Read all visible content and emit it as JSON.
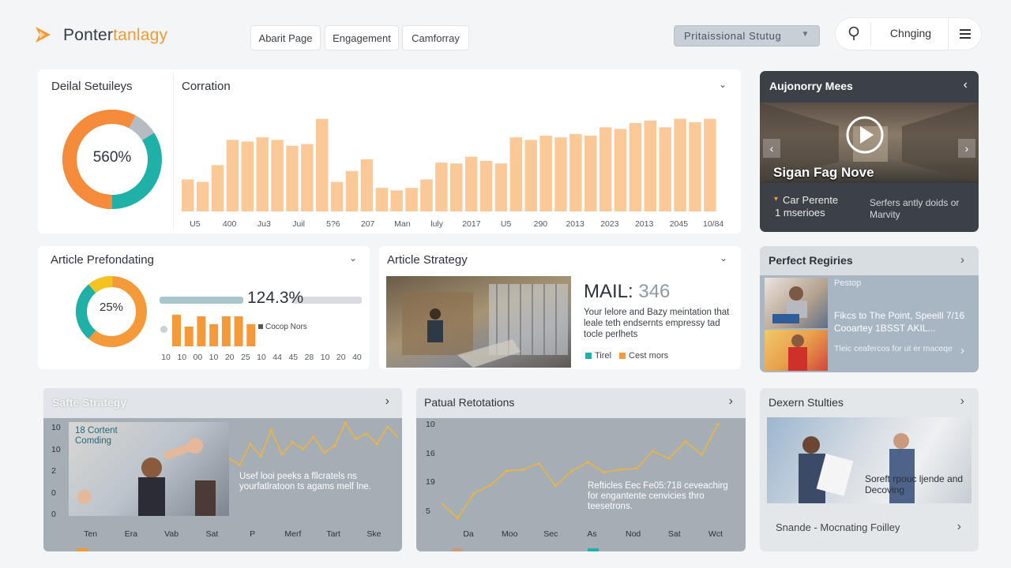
{
  "header": {
    "brand_part1": "Ponter",
    "brand_part2": "tanlagy",
    "nav": [
      "Abarit Page",
      "Engagement",
      "Camforray"
    ],
    "status_dropdown": "Pritaissional  Stutug",
    "right_label": "Chnging"
  },
  "colors": {
    "accent": "#f29a32",
    "teal": "#1fb0a8",
    "bar": "#fbc998",
    "dark_panel": "#3c4148"
  },
  "detail": {
    "title": "Deilal Setuileys",
    "donut_value": "560%"
  },
  "corration": {
    "title": "Corration"
  },
  "chart_data": [
    {
      "type": "bar",
      "title": "Corration",
      "values": [
        38,
        35,
        55,
        85,
        83,
        88,
        85,
        78,
        80,
        110,
        35,
        48,
        62,
        28,
        25,
        28,
        38,
        58,
        57,
        65,
        60,
        57,
        88,
        85,
        90,
        88,
        92,
        90,
        100,
        98,
        105,
        108,
        100,
        110,
        106,
        110
      ],
      "x_tick_labels": [
        "U5",
        "400",
        "Ju3",
        "Juil",
        "5?6",
        "207",
        "Man",
        "luly",
        "2017",
        "U5",
        "290",
        "2013",
        "2023",
        "2013",
        "2045",
        "10/84"
      ],
      "grid": false
    },
    {
      "type": "bar",
      "title": "Article Prefondating",
      "values": [
        40,
        25,
        38,
        28,
        38,
        38,
        28
      ],
      "x_tick_labels": [
        "10",
        "10",
        "00",
        "10",
        "20",
        "25",
        "10",
        "44",
        "45",
        "28",
        "10",
        "20",
        "40"
      ],
      "legend": [
        "Cocop Nors"
      ]
    },
    {
      "type": "line",
      "title": "Safte Strategy",
      "values": [
        55,
        48,
        72,
        58,
        88,
        60,
        74,
        66,
        80,
        62,
        70,
        96,
        78,
        84,
        72,
        92,
        80
      ],
      "y_tick_labels": [
        "10",
        "10",
        "2",
        "0",
        "0"
      ],
      "x_tick_labels": [
        "Ten",
        "Era",
        "Vab",
        "Sat",
        "P",
        "Merf",
        "Tart",
        "Ske"
      ]
    },
    {
      "type": "line",
      "title": "Patual Retotations",
      "values": [
        28,
        4,
        44,
        57,
        80,
        82,
        92,
        56,
        80,
        94,
        78,
        82,
        84,
        112,
        100,
        128,
        106,
        155
      ],
      "y_tick_labels": [
        "10",
        "16",
        "19",
        "5"
      ],
      "x_tick_labels": [
        "Da",
        "Moo",
        "Sec",
        "As",
        "Nod",
        "Sat",
        "Wct"
      ]
    }
  ],
  "autonomy": {
    "title": "Aujonorry Mees",
    "video_title": "Sigan Fag Nove",
    "meta_left1": "Car Perente",
    "meta_left2": "1 mserioes",
    "meta_right": "Serfers antly doids or Marvity"
  },
  "article_pref": {
    "title": "Article Prefondating",
    "donut_value": "25%",
    "big_value": "124.3%",
    "legend": "Cocop Nors"
  },
  "article_strategy": {
    "title": "Article Strategy",
    "metric_label": "MAIL:",
    "metric_value": "346",
    "desc": "Your lelore and Bazy meintation that leale teth endsernts empressy tad tocle perlhets",
    "legend1": "Tirel",
    "legend2": "Cest mors"
  },
  "perfect": {
    "title": "Perfect Regiries",
    "item1_label": "Pestop",
    "item1_text": "Fikcs to The Point, Speeill 7/16 Cooartey 1BSST AKIL...",
    "item2_text": "Tleic ceafercos for ut er maceqe"
  },
  "safte": {
    "title": "Safte Strategy",
    "card_title": "18 Cortent Comding",
    "desc": "Usef looi peeks a fllcratels ns yourfatlratoon ts agams melf lne."
  },
  "patual": {
    "title": "Patual Retotations",
    "desc": "Refticles Eec Fe05:718 ceveachirg for engantente cenvicies thro teesetrons."
  },
  "dexern": {
    "title": "Dexern Stulties",
    "overlay": "Soreft rpouc ljende and Decoving",
    "footer": "Snande - Mocnating Foilley"
  }
}
